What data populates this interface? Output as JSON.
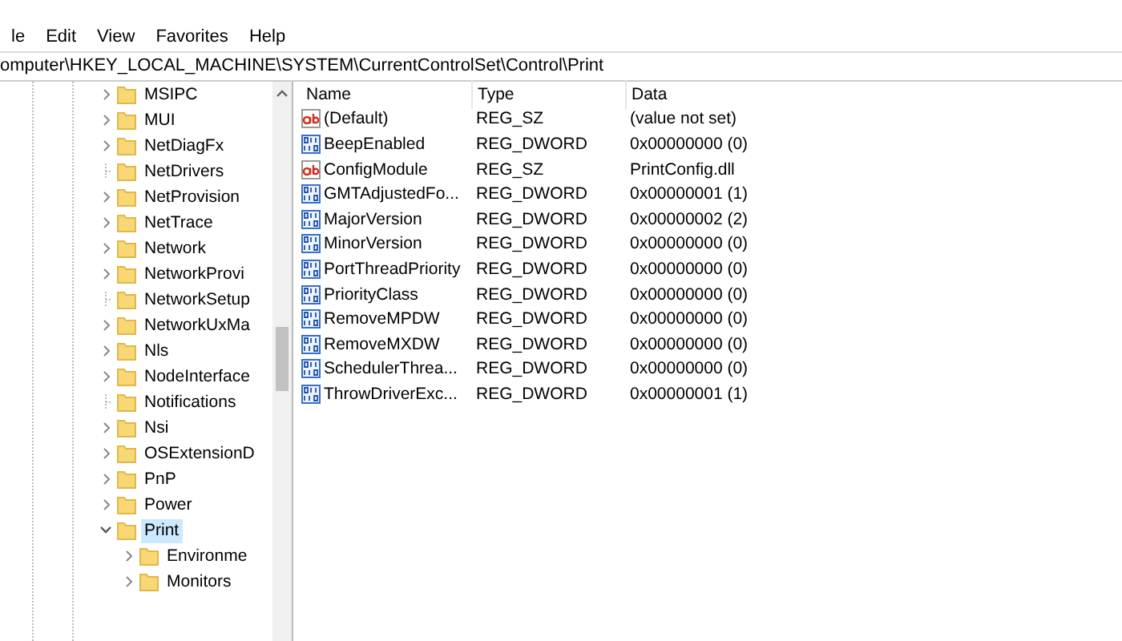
{
  "menu": [
    "le",
    "Edit",
    "View",
    "Favorites",
    "Help"
  ],
  "address": "omputer\\HKEY_LOCAL_MACHINE\\SYSTEM\\CurrentControlSet\\Control\\Print",
  "tree": [
    {
      "label": "MSIPC",
      "expanded": false,
      "selected": false
    },
    {
      "label": "MUI",
      "expanded": false,
      "selected": false
    },
    {
      "label": "NetDiagFx",
      "expanded": false,
      "selected": false
    },
    {
      "label": "NetDrivers",
      "selected": false
    },
    {
      "label": "NetProvision",
      "expanded": false,
      "selected": false
    },
    {
      "label": "NetTrace",
      "expanded": false,
      "selected": false
    },
    {
      "label": "Network",
      "expanded": false,
      "selected": false
    },
    {
      "label": "NetworkProvi",
      "expanded": false,
      "selected": false
    },
    {
      "label": "NetworkSetup",
      "selected": false
    },
    {
      "label": "NetworkUxMa",
      "expanded": false,
      "selected": false
    },
    {
      "label": "Nls",
      "expanded": false,
      "selected": false
    },
    {
      "label": "NodeInterface",
      "expanded": false,
      "selected": false
    },
    {
      "label": "Notifications",
      "selected": false
    },
    {
      "label": "Nsi",
      "expanded": false,
      "selected": false
    },
    {
      "label": "OSExtensionD",
      "expanded": false,
      "selected": false
    },
    {
      "label": "PnP",
      "expanded": false,
      "selected": false
    },
    {
      "label": "Power",
      "expanded": false,
      "selected": false
    },
    {
      "label": "Print",
      "expanded": true,
      "selected": true,
      "children": [
        {
          "label": "Environme",
          "expanded": false,
          "selected": false
        },
        {
          "label": "Monitors",
          "expanded": false,
          "selected": false
        }
      ]
    }
  ],
  "table": {
    "columns": [
      "Name",
      "Type",
      "Data"
    ],
    "rows": [
      {
        "kind": "string",
        "name": "(Default)",
        "type": "REG_SZ",
        "data": "(value not set)"
      },
      {
        "kind": "dword",
        "name": "BeepEnabled",
        "type": "REG_DWORD",
        "data": "0x00000000 (0)"
      },
      {
        "kind": "string",
        "name": "ConfigModule",
        "type": "REG_SZ",
        "data": "PrintConfig.dll"
      },
      {
        "kind": "dword",
        "name": "GMTAdjustedFo...",
        "type": "REG_DWORD",
        "data": "0x00000001 (1)"
      },
      {
        "kind": "dword",
        "name": "MajorVersion",
        "type": "REG_DWORD",
        "data": "0x00000002 (2)"
      },
      {
        "kind": "dword",
        "name": "MinorVersion",
        "type": "REG_DWORD",
        "data": "0x00000000 (0)"
      },
      {
        "kind": "dword",
        "name": "PortThreadPriority",
        "type": "REG_DWORD",
        "data": "0x00000000 (0)"
      },
      {
        "kind": "dword",
        "name": "PriorityClass",
        "type": "REG_DWORD",
        "data": "0x00000000 (0)"
      },
      {
        "kind": "dword",
        "name": "RemoveMPDW",
        "type": "REG_DWORD",
        "data": "0x00000000 (0)"
      },
      {
        "kind": "dword",
        "name": "RemoveMXDW",
        "type": "REG_DWORD",
        "data": "0x00000000 (0)"
      },
      {
        "kind": "dword",
        "name": "SchedulerThrea...",
        "type": "REG_DWORD",
        "data": "0x00000000 (0)"
      },
      {
        "kind": "dword",
        "name": "ThrowDriverExc...",
        "type": "REG_DWORD",
        "data": "0x00000001 (1)"
      }
    ]
  }
}
